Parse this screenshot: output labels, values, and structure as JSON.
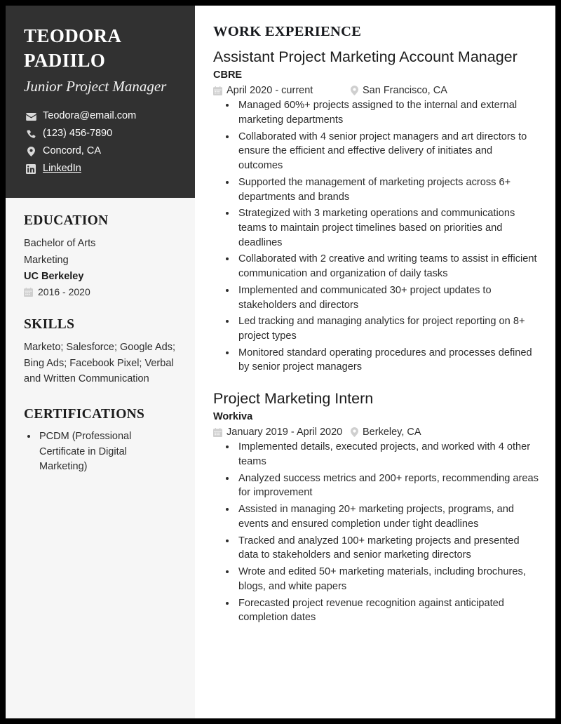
{
  "profile": {
    "name": "TEODORA PADIILO",
    "title": "Junior Project Manager",
    "contacts": [
      {
        "icon": "envelope-icon",
        "text": "Teodora@email.com",
        "link": false
      },
      {
        "icon": "phone-icon",
        "text": "(123) 456-7890",
        "link": false
      },
      {
        "icon": "map-pin-icon",
        "text": "Concord, CA",
        "link": false
      },
      {
        "icon": "linkedin-icon",
        "text": "LinkedIn",
        "link": true
      }
    ]
  },
  "education": {
    "heading": "EDUCATION",
    "degree": "Bachelor of Arts",
    "field": "Marketing",
    "school": "UC Berkeley",
    "dates": "2016 - 2020",
    "date_icon": "calendar-icon"
  },
  "skills": {
    "heading": "SKILLS",
    "text": "Marketo; Salesforce; Google Ads; Bing Ads; Facebook Pixel; Verbal and Written Communication"
  },
  "certifications": {
    "heading": "CERTIFICATIONS",
    "items": [
      "PCDM (Professional Certificate in Digital Marketing)"
    ]
  },
  "work": {
    "heading": "WORK EXPERIENCE",
    "jobs": [
      {
        "role": "Assistant Project Marketing Account Manager",
        "company": "CBRE",
        "dates": "April 2020 - current",
        "location": "San Francisco, CA",
        "date_icon": "calendar-icon",
        "location_icon": "map-pin-icon",
        "bullets": [
          "Managed 60%+ projects assigned to the internal and external marketing departments",
          "Collaborated with 4 senior project managers and art directors to ensure the efficient and effective delivery of initiates and outcomes",
          "Supported the management of marketing projects across 6+ departments and brands",
          "Strategized with 3 marketing operations and communications teams to maintain project timelines based on priorities and deadlines",
          "Collaborated with 2 creative and writing teams to assist in efficient communication and organization of daily tasks",
          "Implemented and communicated 30+ project updates to stakeholders and directors",
          "Led tracking and managing analytics for project reporting on 8+ project types",
          "Monitored standard operating procedures and processes defined by senior project managers"
        ]
      },
      {
        "role": "Project Marketing Intern",
        "company": "Workiva",
        "dates": "January 2019 - April 2020",
        "location": "Berkeley, CA",
        "date_icon": "calendar-icon",
        "location_icon": "map-pin-icon",
        "bullets": [
          "Implemented details, executed projects, and worked with 4 other teams",
          "Analyzed success metrics and 200+ reports, recommending areas for improvement",
          "Assisted in managing 20+ marketing projects, programs, and events and ensured completion under tight deadlines",
          "Tracked and analyzed 100+ marketing projects and presented data to stakeholders and senior marketing directors",
          "Wrote and edited 50+ marketing materials, including brochures, blogs, and white papers",
          "Forecasted project revenue recognition against anticipated completion dates"
        ]
      }
    ]
  },
  "colors": {
    "header_background": "#313131",
    "sidebar_background": "#f6f6f6",
    "page_background": "#ffffff",
    "border": "#000000",
    "text_dark": "#1b1b1b",
    "text_body": "#2d2d2d",
    "icon_muted": "#c9c9c9"
  }
}
